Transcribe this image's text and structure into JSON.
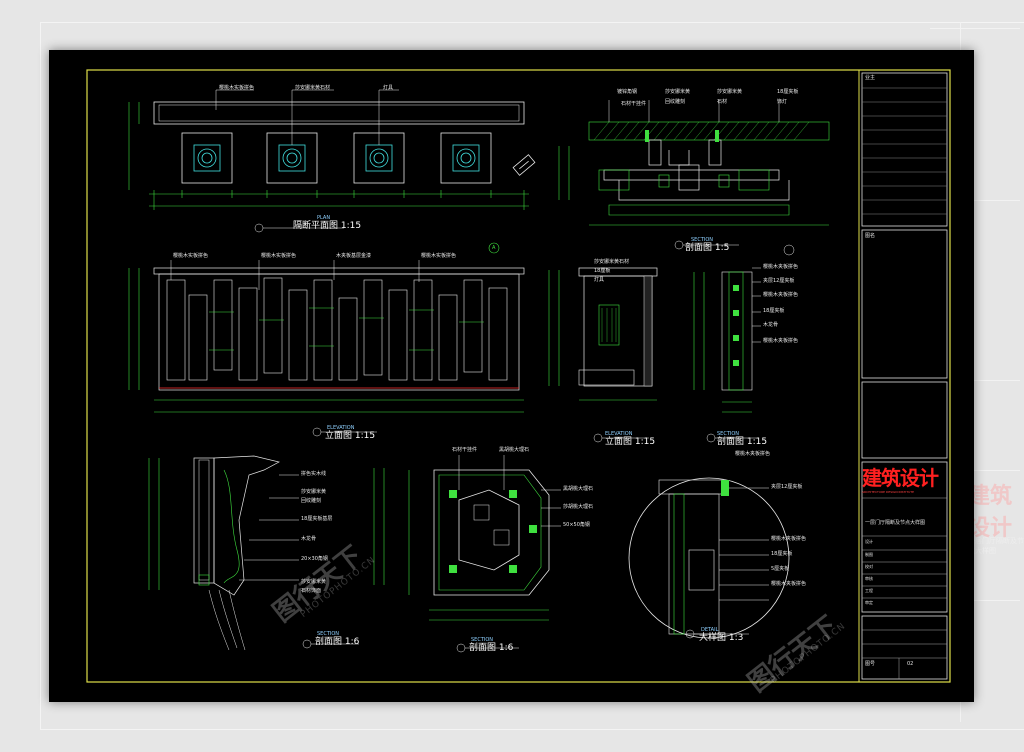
{
  "plan": {
    "labels": [
      "樱桃木实板拼色",
      "莎安娜米黄石材",
      "灯具"
    ],
    "title": "隔断平面图 1:15",
    "tag": "PLAN"
  },
  "elevation": {
    "labels": [
      "樱桃木实板拼色",
      "樱桃木实板拼色",
      "木夹板基层金漆",
      "樱桃木实板拼色"
    ],
    "title": "立面图 1:15",
    "tag": "ELEVATION",
    "marker": "A"
  },
  "section_top": {
    "labels": [
      "镀锌角钢",
      "莎安娜米黄",
      "石材干挂件",
      "回纹雕刻",
      "莎安娜米黄",
      "石材",
      "18厘夹板",
      "饰灯"
    ],
    "title": "剖面图 1:5",
    "tag": "SECTION"
  },
  "elev_small": {
    "labels": [
      "莎安娜米黄石材",
      "18厘板",
      "灯具"
    ],
    "title": "立面图 1:15",
    "tag": "ELEVATION"
  },
  "section_mid": {
    "labels": [
      "樱桃木夹板拼色",
      "夹层12厘夹板",
      "樱桃木夹板拼色",
      "18厘夹板",
      "木龙骨",
      "樱桃木夹板拼色"
    ],
    "title": "剖面图 1:15",
    "tag": "SECTION"
  },
  "section_left": {
    "labels": [
      "拼色实木线",
      "莎安娜米黄",
      "回纹雕刻",
      "18厘夹板基层",
      "木龙骨",
      "20×30角钢",
      "莎安娜米黄",
      "石材饰面"
    ],
    "title": "剖面图 1:6",
    "tag": "SECTION"
  },
  "section_center": {
    "labels": [
      "石材干挂件",
      "黑胡桃大理石",
      "黑胡桃大理石",
      "莎胡桃大理石",
      "50×50角钢"
    ],
    "title": "剖面图 1:6",
    "tag": "SECTION"
  },
  "detail": {
    "labels": [
      "樱桃木夹板拼色",
      "夹层12厘夹板",
      "樱桃木夹板拼色",
      "18厘夹板",
      "5厘夹板",
      "樱桃木夹板拼色"
    ],
    "title": "大样图 1:3",
    "tag": "DETAIL"
  },
  "title_block": {
    "head": "业主",
    "project": "图名",
    "logo": "建筑设计",
    "logo_sub": "ARCHITECTURE DESIGN INSTITUTE",
    "drawing_name": "一层门厅隔断及节点大样图",
    "fields": [
      "设计",
      "制图",
      "校对",
      "审核",
      "工程",
      "审定"
    ],
    "sheet_label": "图号",
    "sheet_no": "02"
  },
  "watermark": {
    "text": "图行天下",
    "site": "PHOTOPHOTO.CN"
  },
  "colors": {
    "frame": "#dede4a",
    "green": "#3fe03f",
    "cyan": "#42e0e0",
    "red": "#ff2020"
  }
}
